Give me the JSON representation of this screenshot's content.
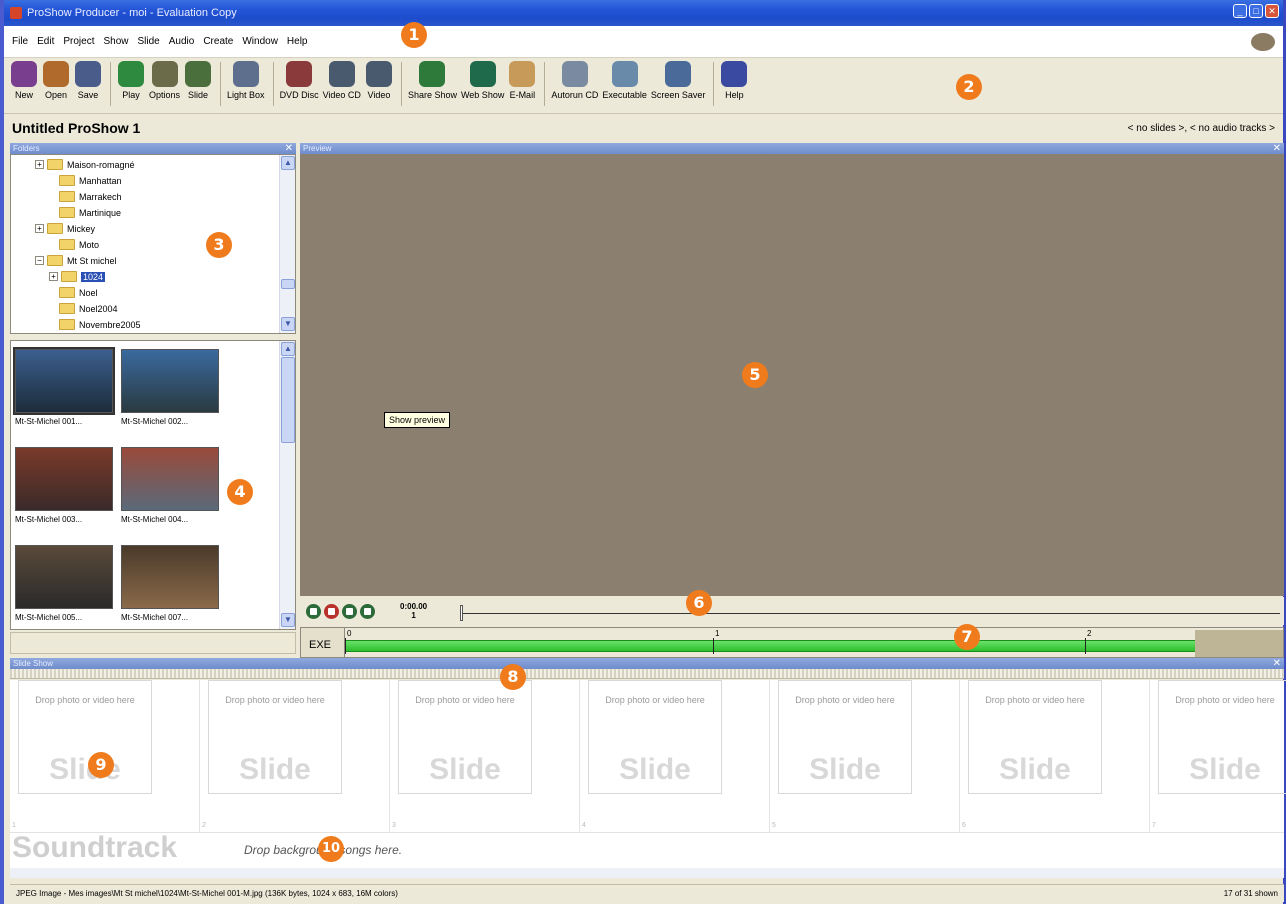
{
  "window": {
    "title": "ProShow Producer - moi - Evaluation Copy"
  },
  "menu": [
    "File",
    "Edit",
    "Project",
    "Show",
    "Slide",
    "Audio",
    "Create",
    "Window",
    "Help"
  ],
  "toolbar": [
    {
      "label": "New",
      "icon": "new-icon",
      "color": "#7a3e8e"
    },
    {
      "label": "Open",
      "icon": "open-icon",
      "color": "#b06a2c"
    },
    {
      "label": "Save",
      "icon": "save-icon",
      "color": "#4a5c8a"
    },
    {
      "label": "Play",
      "icon": "play-icon",
      "color": "#2e8a3f"
    },
    {
      "label": "Options",
      "icon": "options-icon",
      "color": "#6b6b4a"
    },
    {
      "label": "Slide",
      "icon": "slide-icon",
      "color": "#4b6e3d"
    },
    {
      "label": "Light Box",
      "icon": "lightbox-icon",
      "color": "#5e6f8e"
    },
    {
      "label": "DVD Disc",
      "icon": "dvd-icon",
      "color": "#8a3a3a"
    },
    {
      "label": "Video CD",
      "icon": "videocd-icon",
      "color": "#4a5a6e"
    },
    {
      "label": "Video",
      "icon": "video-icon",
      "color": "#4a5a6e"
    },
    {
      "label": "Share Show",
      "icon": "share-icon",
      "color": "#2e7a3a"
    },
    {
      "label": "Web Show",
      "icon": "web-icon",
      "color": "#1f6a4a"
    },
    {
      "label": "E-Mail",
      "icon": "email-icon",
      "color": "#c89a5a"
    },
    {
      "label": "Autorun CD",
      "icon": "autorun-icon",
      "color": "#7a8aa0"
    },
    {
      "label": "Executable",
      "icon": "exe-icon",
      "color": "#6a8aaa"
    },
    {
      "label": "Screen Saver",
      "icon": "screensaver-icon",
      "color": "#4a6a9a"
    },
    {
      "label": "Help",
      "icon": "help-icon",
      "color": "#3a4aa0"
    }
  ],
  "header": {
    "title": "Untitled ProShow 1",
    "stats": "< no slides >, < no audio tracks >"
  },
  "folders_panel": {
    "title": "Folders",
    "items": [
      {
        "label": "Maison-romagné",
        "expand": "+"
      },
      {
        "label": "Manhattan",
        "expand": ""
      },
      {
        "label": "Marrakech",
        "expand": ""
      },
      {
        "label": "Martinique",
        "expand": ""
      },
      {
        "label": "Mickey",
        "expand": "+"
      },
      {
        "label": "Moto",
        "expand": ""
      },
      {
        "label": "Mt St michel",
        "expand": "−"
      },
      {
        "label": "1024",
        "expand": "+"
      },
      {
        "label": "Noel",
        "expand": ""
      },
      {
        "label": "Noel2004",
        "expand": ""
      },
      {
        "label": "Novembre2005",
        "expand": ""
      }
    ]
  },
  "thumbnails": [
    {
      "label": "Mt-St-Michel 001...",
      "c1": "#3b5f8f",
      "c2": "#1d2c3a"
    },
    {
      "label": "Mt-St-Michel 002...",
      "c1": "#3a6a9f",
      "c2": "#2a3a40"
    },
    {
      "label": "Mt-St-Michel 003...",
      "c1": "#7a3a2a",
      "c2": "#3a2a2a"
    },
    {
      "label": "Mt-St-Michel 004...",
      "c1": "#9a4a3a",
      "c2": "#5a6a7a"
    },
    {
      "label": "Mt-St-Michel 005...",
      "c1": "#5a4a3a",
      "c2": "#2a2a2a"
    },
    {
      "label": "Mt-St-Michel 007...",
      "c1": "#4a3a2a",
      "c2": "#8a6a4a"
    }
  ],
  "preview": {
    "title": "Preview",
    "tooltip": "Show preview"
  },
  "transport": {
    "time": "0:00.00",
    "index": "1"
  },
  "timeline": {
    "exe_label": "EXE",
    "ticks": [
      "0",
      "1",
      "2"
    ]
  },
  "slideshow": {
    "title": "Slide Show",
    "drop_text": "Drop photo or video here",
    "slide_word": "Slide",
    "slide_numbers": [
      "1",
      "2",
      "3",
      "4",
      "5",
      "6",
      "7"
    ]
  },
  "soundtrack": {
    "word": "Soundtrack",
    "drop_text": "Drop background songs here."
  },
  "status": {
    "left": "JPEG Image - Mes images\\Mt St michel\\1024\\Mt-St-Michel 001-M.jpg  (136K bytes, 1024 x 683, 16M colors)",
    "right": "17 of 31 shown"
  },
  "badges": [
    "1",
    "2",
    "3",
    "4",
    "5",
    "6",
    "7",
    "8",
    "9",
    "10"
  ],
  "colors": {
    "badge": "#f07b1c",
    "preview_bg": "#8b8070",
    "timeline_green": "#2dbe2d",
    "title_bar": "#2456d8"
  }
}
